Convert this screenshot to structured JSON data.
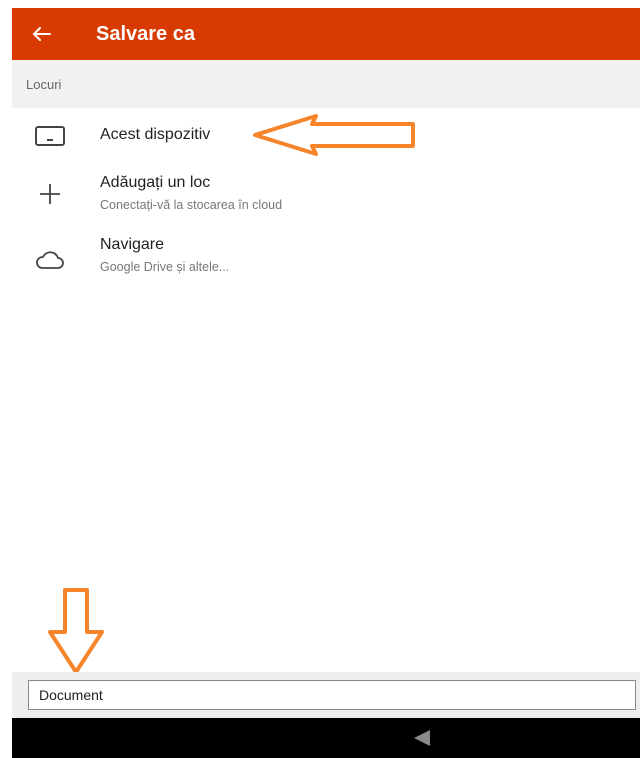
{
  "app_bar": {
    "title": "Salvare ca",
    "background": "#d83b01",
    "back_icon": "arrow-left-icon"
  },
  "places": {
    "header": "Locuri",
    "items": [
      {
        "icon": "tablet-device-icon",
        "label": "Acest dispozitiv",
        "sublabel": ""
      },
      {
        "icon": "plus-icon",
        "label": "Adăugați un loc",
        "sublabel": "Conectați-vă la stocarea în cloud"
      },
      {
        "icon": "cloud-icon",
        "label": "Navigare",
        "sublabel": "Google Drive și altele..."
      }
    ]
  },
  "annotations": {
    "color": "#f5842a",
    "arrows": [
      "arrow-pointing-left",
      "arrow-pointing-down"
    ]
  },
  "filename": {
    "value": "Document"
  },
  "system_nav": {
    "back_icon": "nav-back-triangle-icon"
  }
}
